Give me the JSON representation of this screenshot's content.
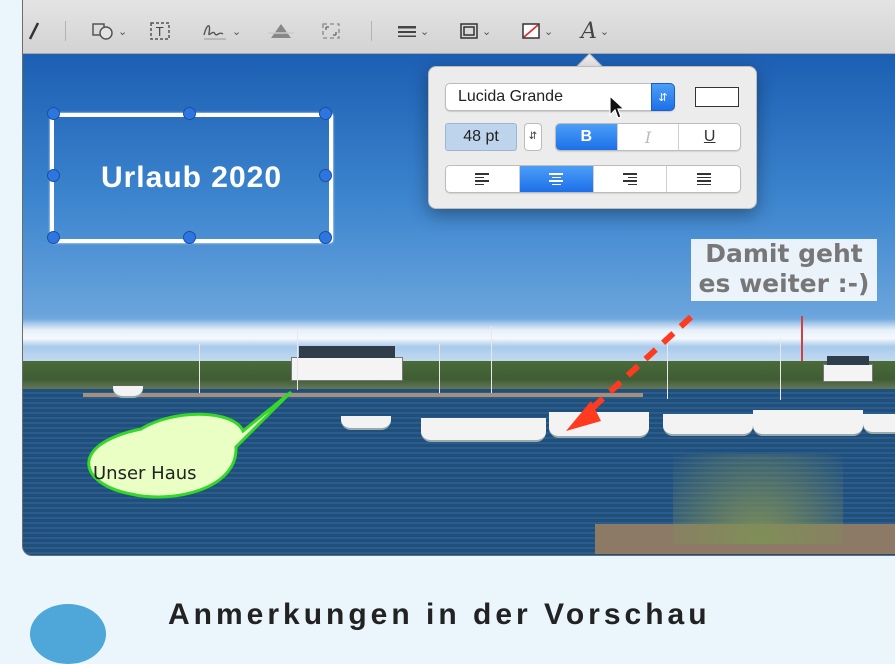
{
  "toolbar": {
    "items": [
      {
        "name": "pen-icon"
      },
      {
        "name": "shapes-icon"
      },
      {
        "name": "text-icon"
      },
      {
        "name": "signature-icon"
      },
      {
        "name": "adjust-color-icon"
      },
      {
        "name": "size-icon"
      },
      {
        "name": "shape-style-icon"
      },
      {
        "name": "border-color-icon"
      },
      {
        "name": "fill-color-icon"
      },
      {
        "name": "text-style-icon"
      }
    ],
    "text_style_glyph": "A"
  },
  "canvas": {
    "textbox_label": "Urlaub 2020",
    "callout_box_line1": "Damit geht",
    "callout_box_line2": "es weiter :-)",
    "speech_bubble_label": "Unser Haus",
    "arrow_color": "#ff3b1f",
    "bubble_fill": "#e9ffc4",
    "bubble_stroke": "#36d62a"
  },
  "format_popover": {
    "font_family": "Lucida Grande",
    "font_size": "48 pt",
    "bold_label": "B",
    "italic_label": "I",
    "underline_label": "U",
    "bold_active": true,
    "alignment_selected": "center",
    "alignments": [
      "left",
      "center",
      "right",
      "justify"
    ]
  },
  "colors": {
    "accent": "#1d70e8",
    "selection_handle": "#2d76e0"
  },
  "bottom_text": "Anmerkungen in der Vorschau"
}
